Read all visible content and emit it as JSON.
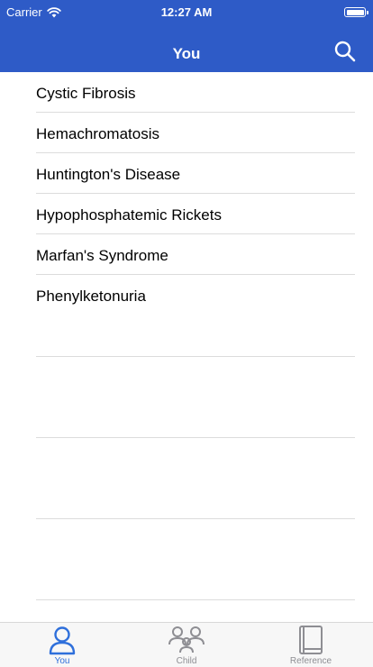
{
  "status_bar": {
    "carrier": "Carrier",
    "time": "12:27 AM"
  },
  "nav": {
    "title": "You",
    "search_icon": "search-icon"
  },
  "conditions": [
    {
      "label": "Cystic Fibrosis"
    },
    {
      "label": "Hemachromatosis"
    },
    {
      "label": "Huntington's Disease"
    },
    {
      "label": "Hypophosphatemic Rickets"
    },
    {
      "label": "Marfan's Syndrome"
    },
    {
      "label": "Phenylketonuria"
    }
  ],
  "tabs": [
    {
      "label": "You",
      "icon": "person-icon",
      "active": true
    },
    {
      "label": "Child",
      "icon": "family-icon",
      "active": false
    },
    {
      "label": "Reference",
      "icon": "book-icon",
      "active": false
    }
  ],
  "colors": {
    "nav_bar": "#2e5bc7",
    "tab_active": "#2e6fdb",
    "tab_inactive": "#8e8e93"
  }
}
